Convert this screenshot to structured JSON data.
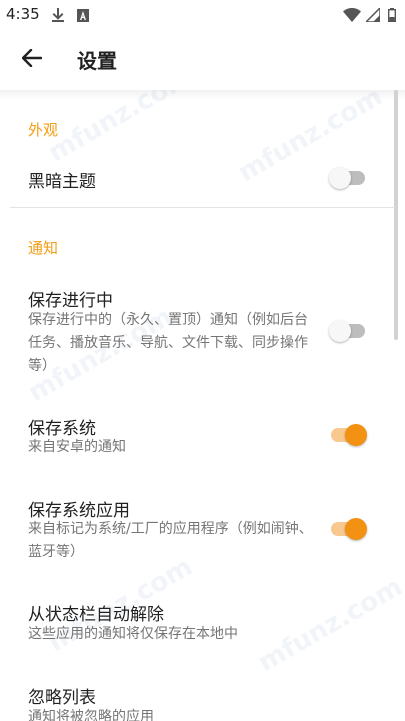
{
  "status_bar": {
    "time": "4:35"
  },
  "app_bar": {
    "title": "设置"
  },
  "sections": [
    {
      "header": "外观"
    },
    {
      "header": "通知"
    }
  ],
  "settings": {
    "dark_theme": {
      "title": "黑暗主题",
      "enabled": false
    },
    "keep_ongoing": {
      "title": "保存进行中",
      "summary": "保存进行中的（永久、置顶）通知（例如后台任务、播放音乐、导航、文件下载、同步操作等）",
      "enabled": false
    },
    "keep_system": {
      "title": "保存系统",
      "summary": "来自安卓的通知",
      "enabled": true
    },
    "keep_system_apps": {
      "title": "保存系统应用",
      "summary": "来自标记为系统/工厂的应用程序（例如闹钟、蓝牙等）",
      "enabled": true
    },
    "auto_dismiss": {
      "title": "从状态栏自动解除",
      "summary": "这些应用的通知将仅保存在本地中"
    },
    "ignore_list": {
      "title": "忽略列表",
      "summary": "通知将被忽略的应用"
    }
  },
  "watermark": "mfunz.com",
  "colors": {
    "accent": "#f39212",
    "section_header": "#f39c12",
    "toggle_off": "#bdbdbd"
  },
  "icons": [
    "download-icon",
    "a-notification-icon",
    "wifi-icon",
    "signal-icon",
    "battery-icon",
    "arrow-back-icon"
  ]
}
